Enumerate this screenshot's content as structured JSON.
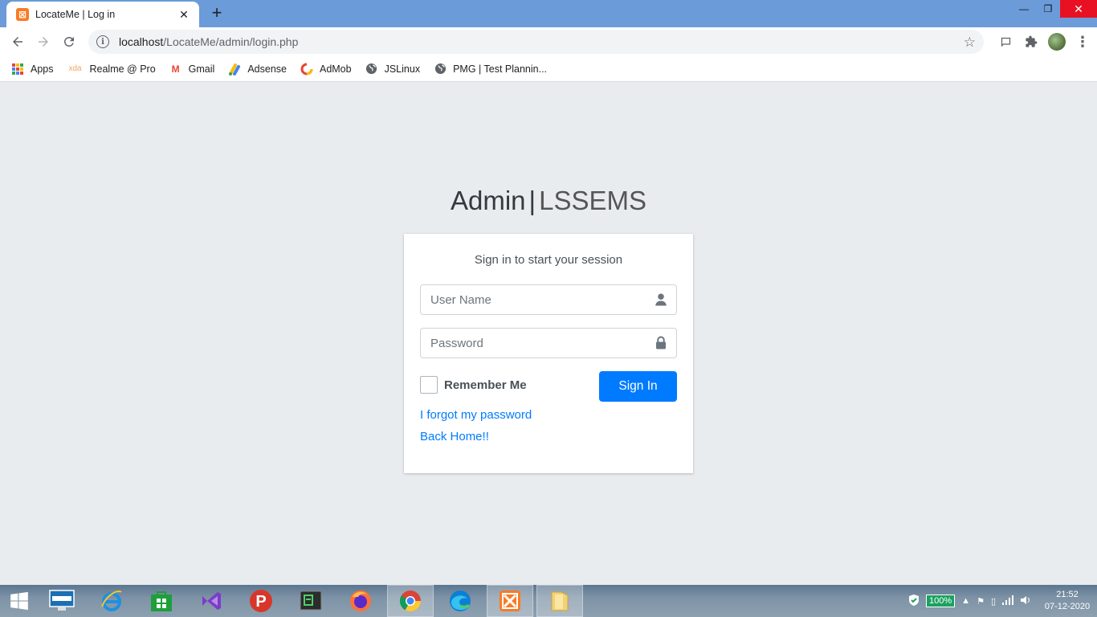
{
  "browser": {
    "tab_title": "LocateMe | Log in",
    "tab_favicon_glyph": "⊠",
    "tab_close": "✕",
    "new_tab": "+",
    "url_host": "localhost",
    "url_path": "/LocateMe/admin/login.php",
    "window_controls": {
      "minimize": "—",
      "restore": "❐",
      "close": "✕"
    }
  },
  "bookmarks": [
    {
      "label": "Apps",
      "icon": "apps-grid-icon"
    },
    {
      "label": "Realme @ Pro",
      "icon": "xda-icon",
      "icon_text": "xda"
    },
    {
      "label": "Gmail",
      "icon": "gmail-icon",
      "icon_text": "M"
    },
    {
      "label": "Adsense",
      "icon": "adsense-icon"
    },
    {
      "label": "AdMob",
      "icon": "admob-icon"
    },
    {
      "label": "JSLinux",
      "icon": "globe-icon"
    },
    {
      "label": "PMG | Test Plannin...",
      "icon": "globe-icon"
    }
  ],
  "login": {
    "logo_main": "Admin",
    "logo_sep": "|",
    "logo_sub": "LSSEMS",
    "message": "Sign in to start your session",
    "username_placeholder": "User Name",
    "password_placeholder": "Password",
    "remember_label": "Remember Me",
    "signin_label": "Sign In",
    "forgot_link": "I forgot my password",
    "home_link": "Back Home!!"
  },
  "taskbar": {
    "battery": "100%",
    "time": "21:52",
    "date": "07-12-2020"
  },
  "colors": {
    "primary": "#007bff",
    "page_bg": "#e9ecef",
    "tabstrip_bg": "#6b9bd8"
  }
}
